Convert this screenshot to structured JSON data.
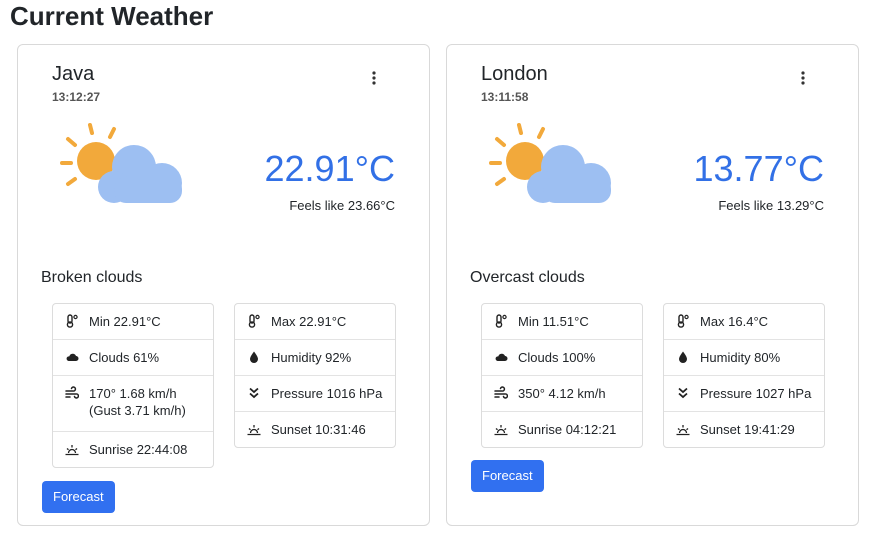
{
  "page": {
    "title": "Current Weather"
  },
  "colors": {
    "accent": "#3170f0",
    "temperature": "#3270e6",
    "sun": "#f2a93b",
    "cloud": "#9dbff2"
  },
  "cards": [
    {
      "city": "Java",
      "time": "13:12:27",
      "icon": "sun-behind-cloud-icon",
      "temperature": "22.91°C",
      "feels_like": "Feels like 23.66°C",
      "condition": "Broken clouds",
      "left_stats": {
        "min": "Min 22.91°C",
        "clouds": "Clouds 61%",
        "wind": "170° 1.68 km/h (Gust 3.71 km/h)",
        "sunrise": "Sunrise 22:44:08"
      },
      "right_stats": {
        "max": "Max 22.91°C",
        "humidity": "Humidity 92%",
        "pressure": "Pressure 1016 hPa",
        "sunset": "Sunset 10:31:46"
      },
      "forecast_label": "Forecast"
    },
    {
      "city": "London",
      "time": "13:11:58",
      "icon": "sun-behind-cloud-icon",
      "temperature": "13.77°C",
      "feels_like": "Feels like 13.29°C",
      "condition": "Overcast clouds",
      "left_stats": {
        "min": "Min 11.51°C",
        "clouds": "Clouds 100%",
        "wind": "350° 4.12 km/h",
        "sunrise": "Sunrise 04:12:21"
      },
      "right_stats": {
        "max": "Max 16.4°C",
        "humidity": "Humidity 80%",
        "pressure": "Pressure 1027 hPa",
        "sunset": "Sunset 19:41:29"
      },
      "forecast_label": "Forecast"
    }
  ]
}
